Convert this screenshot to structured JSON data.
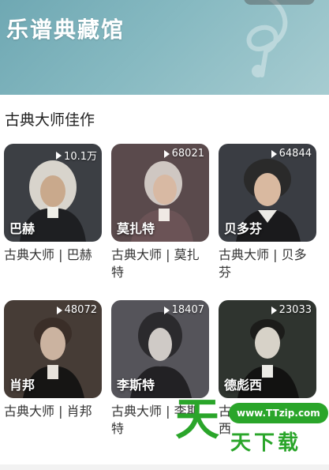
{
  "banner": {
    "title": "乐谱典藏馆",
    "background_color": "#7fb2bb"
  },
  "section": {
    "title": "古典大师佳作"
  },
  "cards": [
    {
      "name": "巴赫",
      "plays": "10.1万",
      "caption": "古典大师 | 巴赫",
      "tone": "#3c3f44"
    },
    {
      "name": "莫扎特",
      "plays": "68021",
      "caption": "古典大师 | 莫扎特",
      "tone": "#5a4a4c"
    },
    {
      "name": "贝多芬",
      "plays": "64844",
      "caption": "古典大师 | 贝多芬",
      "tone": "#3a3d43"
    },
    {
      "name": "肖邦",
      "plays": "48072",
      "caption": "古典大师 | 肖邦",
      "tone": "#463c36"
    },
    {
      "name": "李斯特",
      "plays": "18407",
      "caption": "古典大师 | 李斯特",
      "tone": "#55545a"
    },
    {
      "name": "德彪西",
      "plays": "23033",
      "caption": "古典大师 | 德彪西",
      "tone": "#2f342f"
    }
  ],
  "watermark": {
    "big": "天",
    "url": "www.TTzip.com",
    "small": "天下载"
  }
}
